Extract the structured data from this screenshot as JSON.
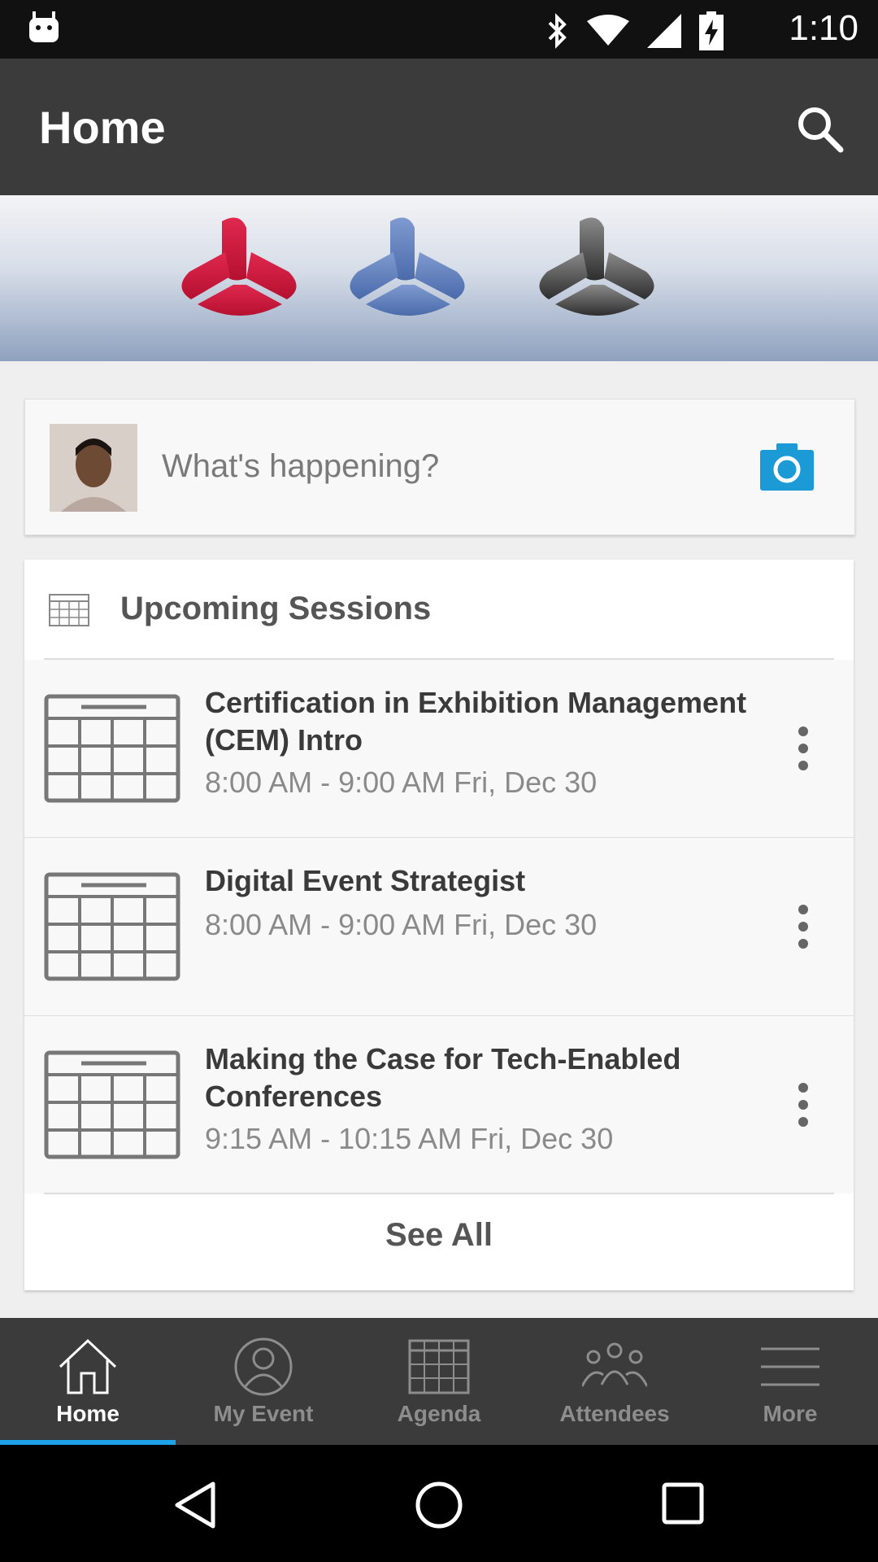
{
  "status_bar": {
    "time": "1:10"
  },
  "app_bar": {
    "title": "Home"
  },
  "composer": {
    "placeholder": "What's happening?"
  },
  "upcoming": {
    "title": "Upcoming Sessions",
    "sessions": [
      {
        "title": "Certification in Exhibition Management (CEM) Intro",
        "time": "8:00 AM - 9:00 AM Fri, Dec 30"
      },
      {
        "title": "Digital Event Strategist",
        "time": "8:00 AM - 9:00 AM Fri, Dec 30"
      },
      {
        "title": "Making the Case for Tech-Enabled Conferences",
        "time": "9:15 AM - 10:15 AM Fri, Dec 30"
      }
    ],
    "see_all": "See All"
  },
  "bottom_nav": {
    "items": [
      {
        "label": "Home",
        "icon": "home-icon",
        "active": true
      },
      {
        "label": "My Event",
        "icon": "person-icon",
        "active": false
      },
      {
        "label": "Agenda",
        "icon": "calendar-icon",
        "active": false
      },
      {
        "label": "Attendees",
        "icon": "people-icon",
        "active": false
      },
      {
        "label": "More",
        "icon": "menu-icon",
        "active": false
      }
    ]
  },
  "colors": {
    "accent": "#1da1e8",
    "camera": "#1b9ad6",
    "app_bar": "#3b3b3b",
    "logo_red": "#c8173d",
    "logo_blue": "#5f7fbe",
    "logo_gray": "#444444"
  }
}
